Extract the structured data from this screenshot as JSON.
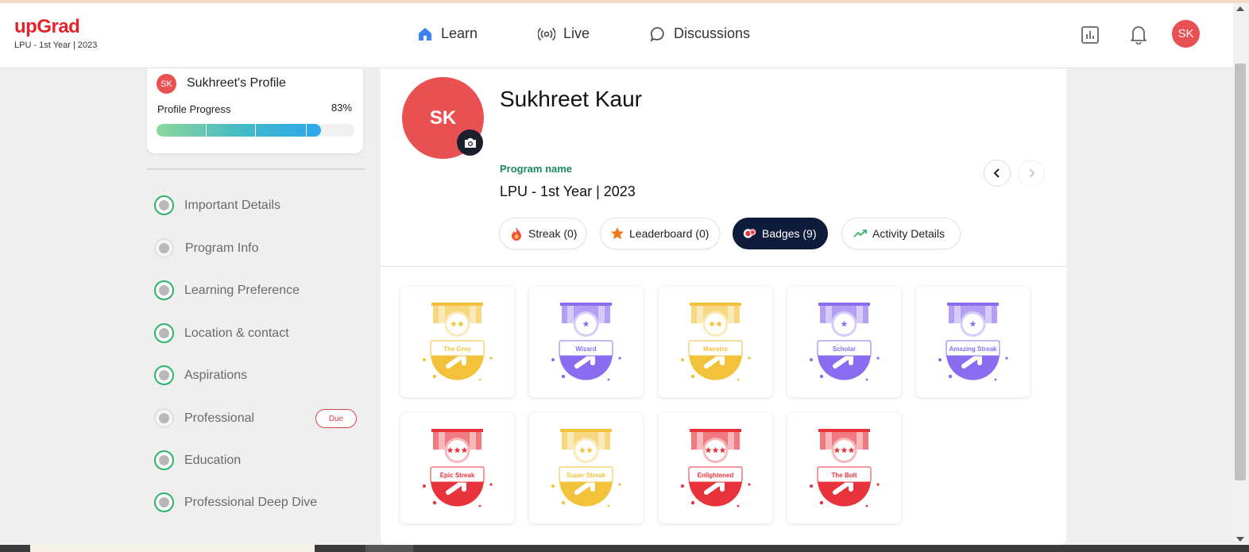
{
  "header": {
    "logo": "upGrad",
    "logo_sub": "LPU - 1st Year | 2023",
    "nav": [
      {
        "label": "Learn",
        "icon": "home-icon"
      },
      {
        "label": "Live",
        "icon": "broadcast-icon"
      },
      {
        "label": "Discussions",
        "icon": "chat-bubble-icon"
      }
    ],
    "user_initials": "SK"
  },
  "sidebar": {
    "profile_initials": "SK",
    "profile_title": "Sukhreet's Profile",
    "progress_label": "Profile Progress",
    "progress_percent": "83%",
    "progress_value": 0.83,
    "items": [
      {
        "label": "Important Details",
        "done": true
      },
      {
        "label": "Program Info",
        "done": false
      },
      {
        "label": "Learning Preference",
        "done": true
      },
      {
        "label": "Location & contact",
        "done": true
      },
      {
        "label": "Aspirations",
        "done": true
      },
      {
        "label": "Professional",
        "done": false
      },
      {
        "label": "Education",
        "done": true
      },
      {
        "label": "Professional Deep Dive",
        "done": true
      }
    ],
    "due_label": "Due"
  },
  "profile": {
    "initials": "SK",
    "name": "Sukhreet Kaur",
    "program_label": "Program name",
    "program_value": "LPU - 1st Year | 2023"
  },
  "tabs": [
    {
      "label": "Streak (0)",
      "icon": "flame-icon",
      "active": false
    },
    {
      "label": "Leaderboard (0)",
      "icon": "star-icon",
      "active": false
    },
    {
      "label": "Badges (9)",
      "icon": "badges-icon",
      "active": true
    },
    {
      "label": "Activity Details",
      "icon": "trend-icon",
      "active": false
    }
  ],
  "badges": [
    {
      "label": "The Grey",
      "color": "#f2c23a",
      "stars": 2
    },
    {
      "label": "Wizard",
      "color": "#8a6cf0",
      "stars": 1
    },
    {
      "label": "Maestro",
      "color": "#f2c23a",
      "stars": 2
    },
    {
      "label": "Scholar",
      "color": "#8a6cf0",
      "stars": 1
    },
    {
      "label": "Amazing Streak",
      "color": "#8a6cf0",
      "stars": 1
    },
    {
      "label": "Epic Streak",
      "color": "#e8323c",
      "stars": 3
    },
    {
      "label": "Super Streak",
      "color": "#f2c23a",
      "stars": 2
    },
    {
      "label": "Enlightened",
      "color": "#e8323c",
      "stars": 3
    },
    {
      "label": "The Bolt",
      "color": "#e8323c",
      "stars": 3
    }
  ]
}
